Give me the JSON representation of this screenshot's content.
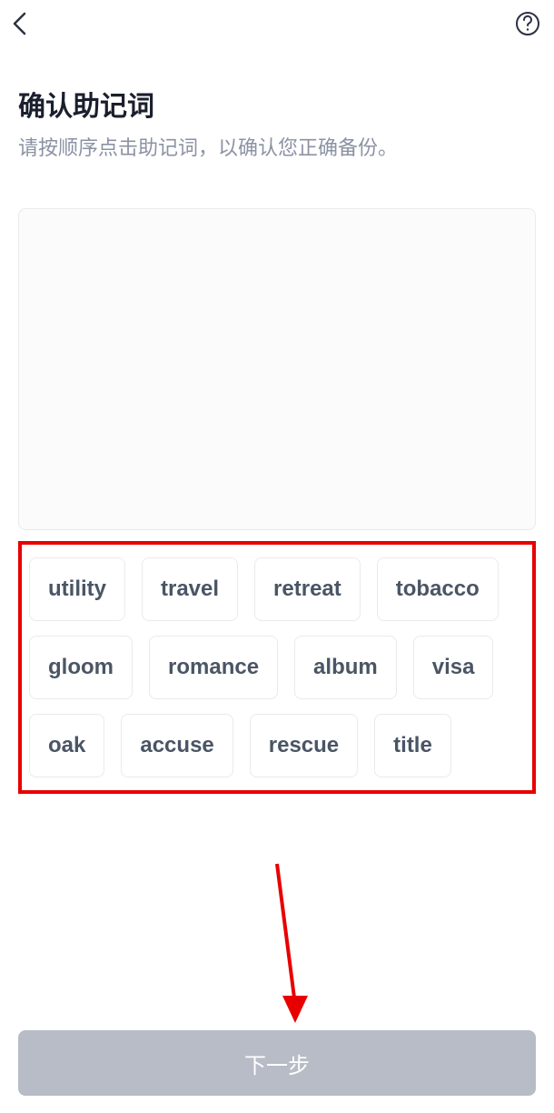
{
  "header": {
    "back_icon": "back-icon",
    "help_icon": "help-icon"
  },
  "title": "确认助记词",
  "subtitle": "请按顺序点击助记词，以确认您正确备份。",
  "words": [
    "utility",
    "travel",
    "retreat",
    "tobacco",
    "gloom",
    "romance",
    "album",
    "visa",
    "oak",
    "accuse",
    "rescue",
    "title"
  ],
  "next_button_label": "下一步",
  "annotation": {
    "highlight_color": "#e80000",
    "arrow_color": "#e80000"
  }
}
